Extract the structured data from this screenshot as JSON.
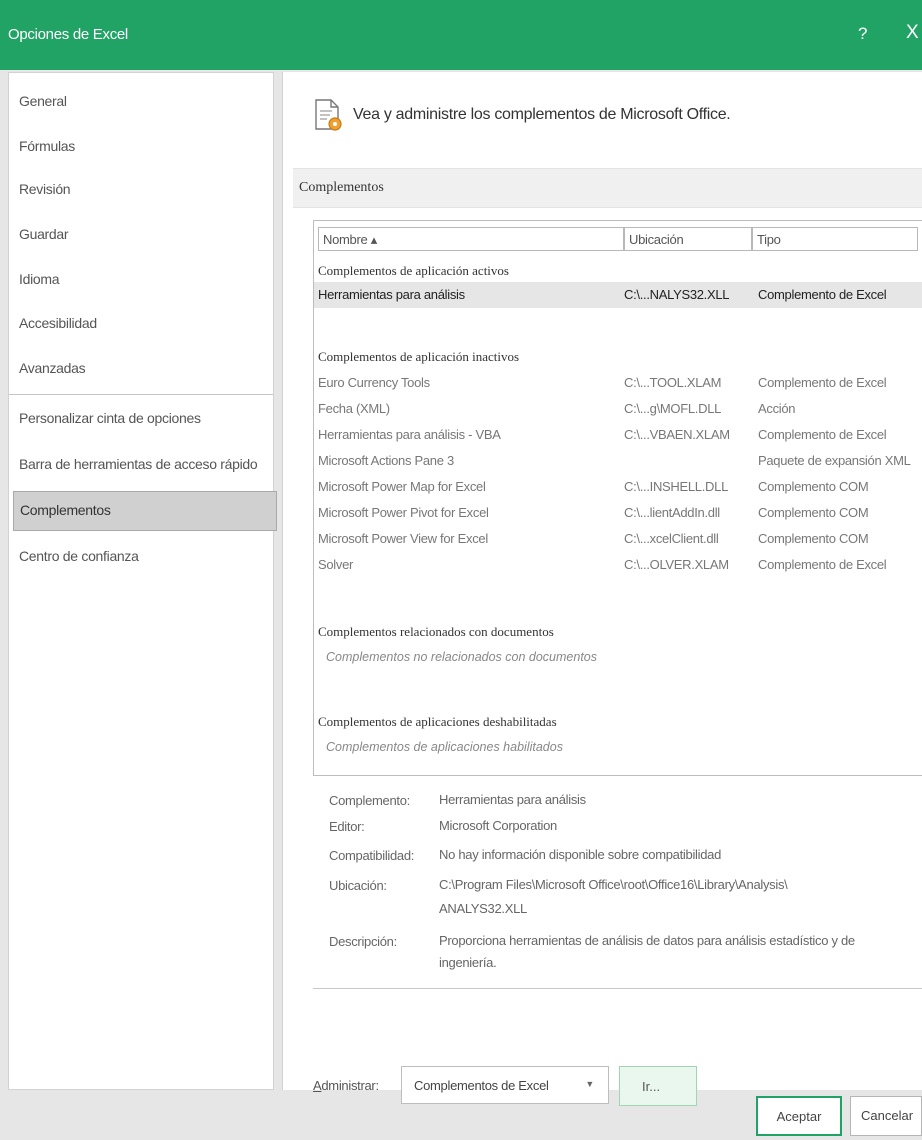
{
  "window": {
    "title": "Opciones de Excel",
    "help_label": "?",
    "close_label": "X"
  },
  "sidebar": {
    "items": [
      {
        "label": "General"
      },
      {
        "label": "Fórmulas"
      },
      {
        "label": "Revisión"
      },
      {
        "label": "Guardar"
      },
      {
        "label": "Idioma"
      },
      {
        "label": "Accesibilidad"
      },
      {
        "label": "Avanzadas"
      },
      {
        "label": "Personalizar cinta de opciones"
      },
      {
        "label": "Barra de herramientas de acceso rápido"
      },
      {
        "label": "Complementos"
      },
      {
        "label": "Centro de confianza"
      }
    ],
    "selected": "Complementos"
  },
  "main": {
    "header": "Vea y administre los complementos de Microsoft Office.",
    "section_title": "Complementos",
    "columns": {
      "name": "Nombre ▴",
      "location": "Ubicación",
      "type": "Tipo"
    },
    "groups": {
      "active": {
        "title": "Complementos de aplicación activos",
        "rows": [
          {
            "name": "Herramientas para análisis",
            "location": "C:\\...NALYS32.XLL",
            "type": "Complemento de Excel"
          }
        ]
      },
      "inactive": {
        "title": "Complementos de aplicación inactivos",
        "rows": [
          {
            "name": "Euro Currency Tools",
            "location": "C:\\...TOOL.XLAM",
            "type": "Complemento de Excel"
          },
          {
            "name": "Fecha (XML)",
            "location": "C:\\...g\\MOFL.DLL",
            "type": "Acción"
          },
          {
            "name": "Herramientas para análisis - VBA",
            "location": "C:\\...VBAEN.XLAM",
            "type": "Complemento de Excel"
          },
          {
            "name": "Microsoft Actions Pane 3",
            "location": "",
            "type": "Paquete de expansión XML"
          },
          {
            "name": "Microsoft Power Map for Excel",
            "location": "C:\\...INSHELL.DLL",
            "type": "Complemento COM"
          },
          {
            "name": "Microsoft Power Pivot for Excel",
            "location": "C:\\...lientAddIn.dll",
            "type": "Complemento COM"
          },
          {
            "name": "Microsoft Power View for Excel",
            "location": "C:\\...xcelClient.dll",
            "type": "Complemento COM"
          },
          {
            "name": "Solver",
            "location": "C:\\...OLVER.XLAM",
            "type": "Complemento de Excel"
          }
        ]
      },
      "document": {
        "title": "Complementos relacionados con documentos",
        "note": "Complementos no relacionados con documentos"
      },
      "disabled": {
        "title": "Complementos de aplicaciones deshabilitadas",
        "note": "Complementos de aplicaciones habilitados"
      }
    },
    "details": {
      "addin_label": "Complemento:",
      "addin_value": "Herramientas para análisis",
      "publisher_label": "Editor:",
      "publisher_value": "Microsoft Corporation",
      "compat_label": "Compatibilidad:",
      "compat_value": "No hay información disponible sobre compatibilidad",
      "location_label": "Ubicación:",
      "location_value_1": "C:\\Program Files\\Microsoft Office\\root\\Office16\\Library\\Analysis\\",
      "location_value_2": "ANALYS32.XLL",
      "desc_label": "Descripción:",
      "desc_value_1": "Proporciona herramientas de análisis de datos para análisis estadístico y de",
      "desc_value_2": "ingeniería."
    },
    "manage": {
      "label_first": "A",
      "label_rest": "dministrar:",
      "selected": "Complementos de Excel",
      "go_label": "Ir..."
    }
  },
  "footer": {
    "ok_label": "Aceptar",
    "cancel_label": "Cancelar"
  }
}
